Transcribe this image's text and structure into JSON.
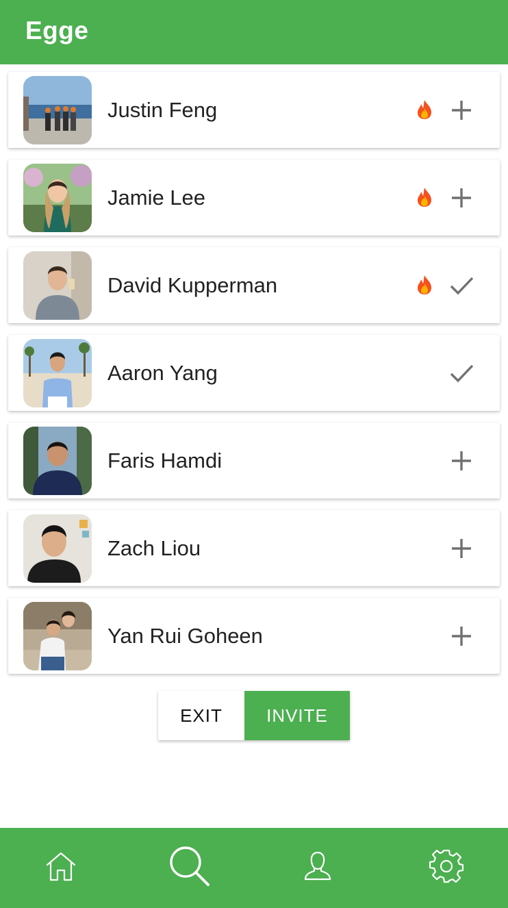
{
  "header": {
    "title": "Egge",
    "color": "#4caf50"
  },
  "friends": [
    {
      "name": "Justin Feng",
      "streak": true,
      "status": "add",
      "action_icon": "plus-icon"
    },
    {
      "name": "Jamie Lee",
      "streak": true,
      "status": "add",
      "action_icon": "plus-icon"
    },
    {
      "name": "David Kupperman",
      "streak": true,
      "status": "added",
      "action_icon": "check-icon"
    },
    {
      "name": "Aaron Yang",
      "streak": false,
      "status": "added",
      "action_icon": "check-icon"
    },
    {
      "name": "Faris Hamdi",
      "streak": false,
      "status": "add",
      "action_icon": "plus-icon"
    },
    {
      "name": "Zach Liou",
      "streak": false,
      "status": "add",
      "action_icon": "plus-icon"
    },
    {
      "name": "Yan Rui Goheen",
      "streak": false,
      "status": "add",
      "action_icon": "plus-icon"
    }
  ],
  "actions": {
    "exit_label": "EXIT",
    "invite_label": "INVITE"
  },
  "bottom_nav": {
    "items": [
      {
        "icon": "home-icon"
      },
      {
        "icon": "search-icon"
      },
      {
        "icon": "profile-icon"
      },
      {
        "icon": "settings-icon"
      }
    ]
  },
  "colors": {
    "accent": "#4caf50",
    "icon_gray": "#707070",
    "text": "#222222"
  }
}
